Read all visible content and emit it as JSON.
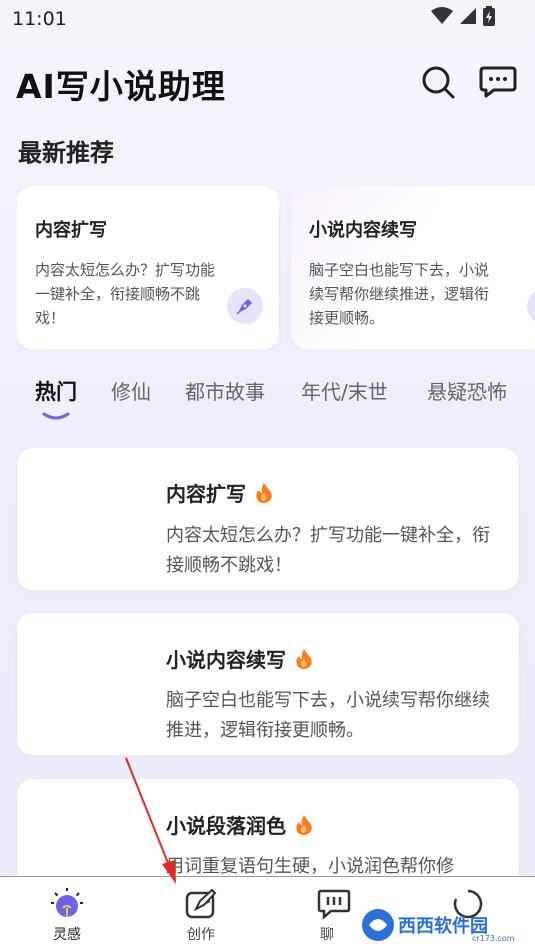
{
  "status_bar": {
    "time": "11:01"
  },
  "header": {
    "title": "AI写小说助理"
  },
  "featured": {
    "section_title": "最新推荐",
    "cards": [
      {
        "title": "内容扩写",
        "desc": "内容太短怎么办？扩写功能一键补全，衔接顺畅不跳戏！"
      },
      {
        "title": "小说内容续写",
        "desc": "脑子空白也能写下去，小说续写帮你继续推进，逻辑衔接更顺畅。"
      }
    ]
  },
  "tabs": [
    "热门",
    "修仙",
    "都市故事",
    "年代/末世",
    "悬疑恐怖"
  ],
  "list": [
    {
      "title": "内容扩写",
      "desc": "内容太短怎么办？扩写功能一键补全，衔接顺畅不跳戏！"
    },
    {
      "title": "小说内容续写",
      "desc": "脑子空白也能写下去，小说续写帮你继续推进，逻辑衔接更顺畅。"
    },
    {
      "title": "小说段落润色",
      "desc": "用词重复语句生硬，小说润色帮你修"
    }
  ],
  "nav": {
    "items": [
      {
        "label": "灵感"
      },
      {
        "label": "创作"
      },
      {
        "label": "聊"
      }
    ]
  },
  "watermark": {
    "text": "西西软件园"
  },
  "colors": {
    "accent": "#6b63e8",
    "fire": "#ff7a1a",
    "watermark": "#2d6fd8"
  }
}
